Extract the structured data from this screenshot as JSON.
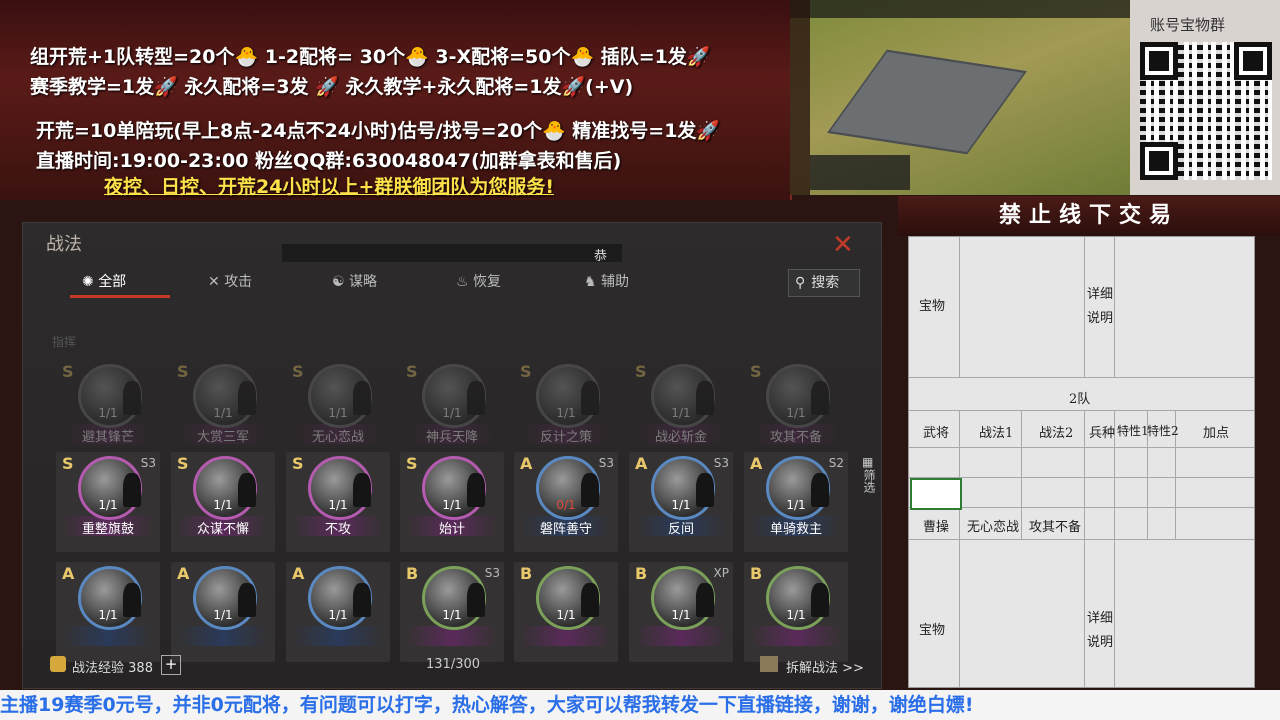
{
  "banner": {
    "line1": "组开荒+1队转型=20个🐣  1-2配将= 30个🐣   3-X配将=50个🐣   插队=1发🚀",
    "line2": "赛季教学=1发🚀 永久配将=3发 🚀 永久教学+永久配将=1发🚀(+V)",
    "line3": "开荒=10单陪玩(早上8点-24点不24小时)估号/找号=20个🐣 精准找号=1发🚀",
    "line4": "直播时间:19:00-23:00   粉丝QQ群:630048047(加群拿表和售后)",
    "line5": "夜控、日控、开荒24小时以上+群朕御团队为您服务!"
  },
  "qr": {
    "label": "账号宝物群"
  },
  "notice": {
    "text": "禁止线下交易"
  },
  "sheet": {
    "treasure_label": "宝物",
    "detail_label_1": "详细",
    "detail_label_2": "说明",
    "team_label": "2队",
    "headers": [
      "武将",
      "战法1",
      "战法2",
      "兵种",
      "特性1",
      "特性2",
      "加点"
    ],
    "row_general": "曹操",
    "row_skill1": "无心恋战",
    "row_skill2": "攻其不备",
    "bottom_treasure": "宝物",
    "bottom_detail_1": "详细",
    "bottom_detail_2": "说明"
  },
  "panel": {
    "title": "战法",
    "close_icon": "close-icon",
    "header_center": "恭",
    "tabs": [
      "全部",
      "攻击",
      "谋略",
      "恢复",
      "辅助"
    ],
    "search_label": "搜索",
    "section_label": "指挥",
    "filter_label": "筛选",
    "exp_label": "战法经验",
    "exp_value": "388",
    "plus_label": "+",
    "count": "131/300",
    "decompose_label": "拆解战法 >>"
  },
  "rows": [
    {
      "dim": true,
      "cards": [
        {
          "rank": "S",
          "count": "1/1",
          "name": "避其锋芒",
          "season": "",
          "color": "gray"
        },
        {
          "rank": "S",
          "count": "1/1",
          "name": "大赏三军",
          "season": "",
          "color": "gray"
        },
        {
          "rank": "S",
          "count": "1/1",
          "name": "无心恋战",
          "season": "",
          "color": "gray"
        },
        {
          "rank": "S",
          "count": "1/1",
          "name": "神兵天降",
          "season": "",
          "color": "gray"
        },
        {
          "rank": "S",
          "count": "1/1",
          "name": "反计之策",
          "season": "",
          "color": "gray"
        },
        {
          "rank": "S",
          "count": "1/1",
          "name": "战必斩金",
          "season": "",
          "color": "gray"
        },
        {
          "rank": "S",
          "count": "1/1",
          "name": "攻其不备",
          "season": "",
          "color": "gray"
        }
      ]
    },
    {
      "dim": false,
      "cards": [
        {
          "rank": "S",
          "count": "1/1",
          "name": "重整旗鼓",
          "season": "S3",
          "color": "pink"
        },
        {
          "rank": "S",
          "count": "1/1",
          "name": "众谋不懈",
          "season": "",
          "color": "pink"
        },
        {
          "rank": "S",
          "count": "1/1",
          "name": "不攻",
          "season": "",
          "color": "pink"
        },
        {
          "rank": "S",
          "count": "1/1",
          "name": "始计",
          "season": "",
          "color": "pink"
        },
        {
          "rank": "A",
          "count": "0/1",
          "name": "磐阵善守",
          "season": "S3",
          "color": "blue"
        },
        {
          "rank": "A",
          "count": "1/1",
          "name": "反间",
          "season": "S3",
          "color": "blue"
        },
        {
          "rank": "A",
          "count": "1/1",
          "name": "单骑救主",
          "season": "S2",
          "color": "blue"
        }
      ]
    },
    {
      "dim": false,
      "cards": [
        {
          "rank": "A",
          "count": "1/1",
          "name": "",
          "season": "",
          "color": "blue"
        },
        {
          "rank": "A",
          "count": "1/1",
          "name": "",
          "season": "",
          "color": "blue"
        },
        {
          "rank": "A",
          "count": "1/1",
          "name": "",
          "season": "",
          "color": "blue"
        },
        {
          "rank": "B",
          "count": "1/1",
          "name": "",
          "season": "S3",
          "color": "green"
        },
        {
          "rank": "B",
          "count": "1/1",
          "name": "",
          "season": "",
          "color": "green"
        },
        {
          "rank": "B",
          "count": "1/1",
          "name": "",
          "season": "XP",
          "color": "green"
        },
        {
          "rank": "B",
          "count": "1/1",
          "name": "",
          "season": "",
          "color": "green"
        }
      ]
    }
  ],
  "ticker": {
    "text": "主播19赛季0元号，并非0元配将，有问题可以打字，热心解答，大家可以帮我转发一下直播链接，谢谢，谢绝白嫖!"
  },
  "colors": {
    "rank_s": "#e8c86a",
    "rank_a": "#e8c86a",
    "rank_b": "#e8c86a",
    "accent": "#c23a2a",
    "ticker_text": "#2a6ee8"
  }
}
